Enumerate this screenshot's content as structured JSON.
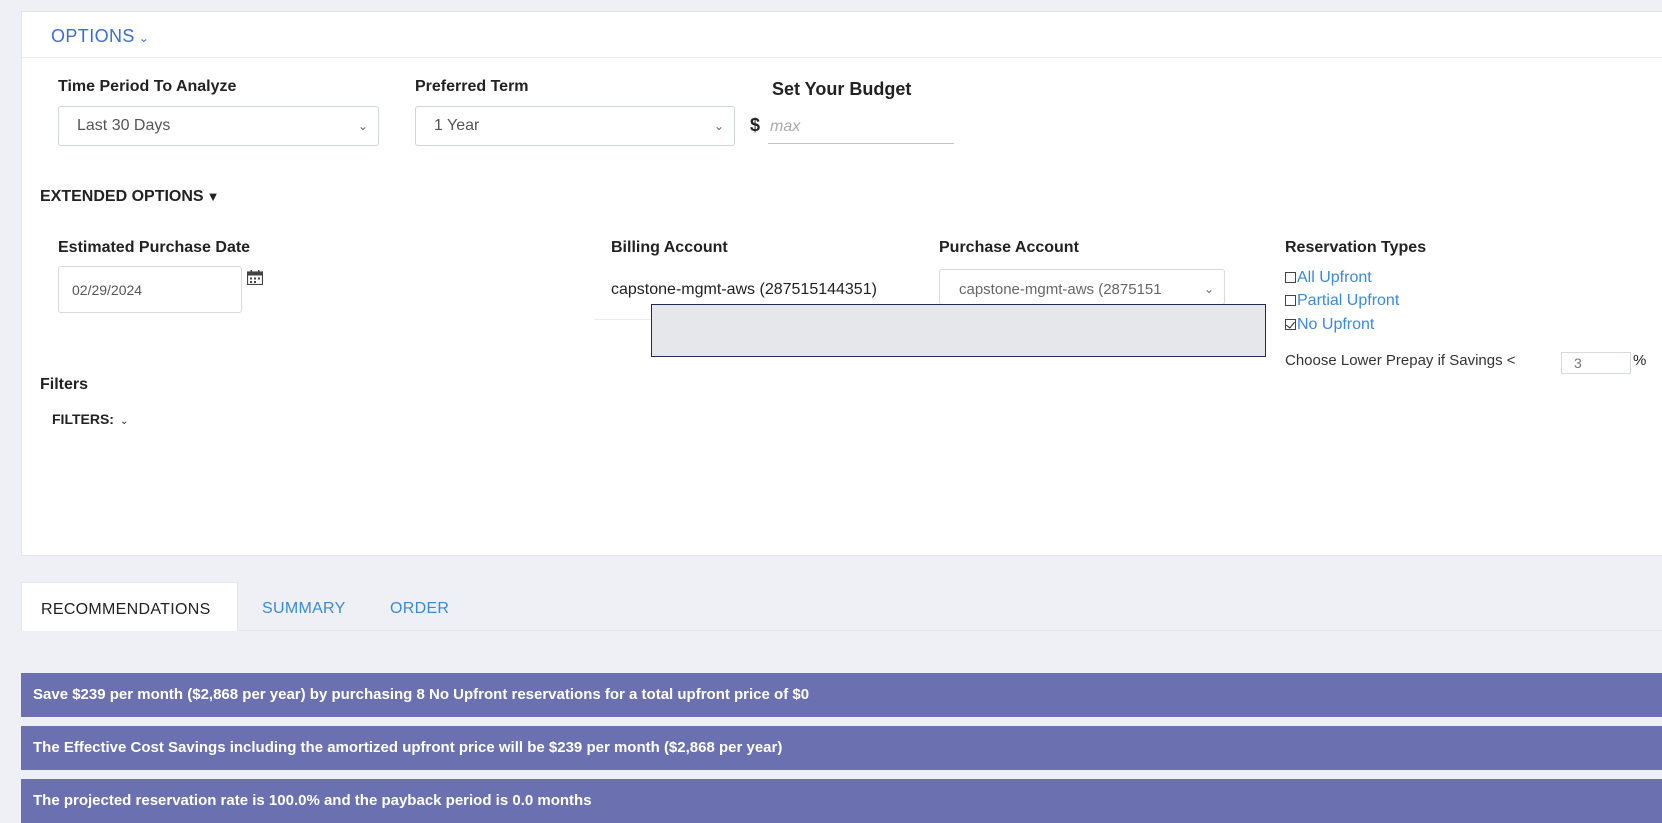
{
  "options": {
    "toggle_label": "OPTIONS",
    "toggle_chevron": "chevron-down-icon"
  },
  "time_period": {
    "label": "Time Period To Analyze",
    "selected": "Last 30 Days"
  },
  "preferred_term": {
    "label": "Preferred Term",
    "selected": "1 Year"
  },
  "budget": {
    "label": "Set Your Budget",
    "currency_symbol": "$",
    "placeholder": "max",
    "value": ""
  },
  "extended_options": {
    "toggle_label": "EXTENDED OPTIONS"
  },
  "purchase_date": {
    "label": "Estimated Purchase Date",
    "value": "02/29/2024",
    "icon": "calendar-icon"
  },
  "billing_account": {
    "label": "Billing Account",
    "value": "capstone-mgmt-aws (287515144351)"
  },
  "purchase_account": {
    "label": "Purchase Account",
    "selected": "capstone-mgmt-aws (2875151"
  },
  "reservation_types": {
    "label": "Reservation Types",
    "items": [
      {
        "label": "All Upfront",
        "checked": false
      },
      {
        "label": "Partial Upfront",
        "checked": false
      },
      {
        "label": "No Upfront",
        "checked": true
      }
    ],
    "prepay_label": "Choose Lower Prepay if Savings <",
    "prepay_value": "3",
    "prepay_unit": "%"
  },
  "filters": {
    "heading": "Filters",
    "toggle_label": "FILTERS:"
  },
  "tabs": [
    {
      "label": "RECOMMENDATIONS",
      "active": true
    },
    {
      "label": "SUMMARY",
      "active": false
    },
    {
      "label": "ORDER",
      "active": false
    }
  ],
  "banners": [
    "Save $239 per month ($2,868 per year) by purchasing 8 No Upfront reservations for a total upfront price of $0",
    "The Effective Cost Savings including the amortized upfront price will be $239 per month ($2,868 per year)",
    "The projected reservation rate is 100.0% and the payback period is 0.0 months"
  ],
  "colors": {
    "link": "#3a8ad6",
    "options_link": "#3b6fc9",
    "banner_bg": "#6b71b0",
    "page_bg": "#eef0f6"
  }
}
